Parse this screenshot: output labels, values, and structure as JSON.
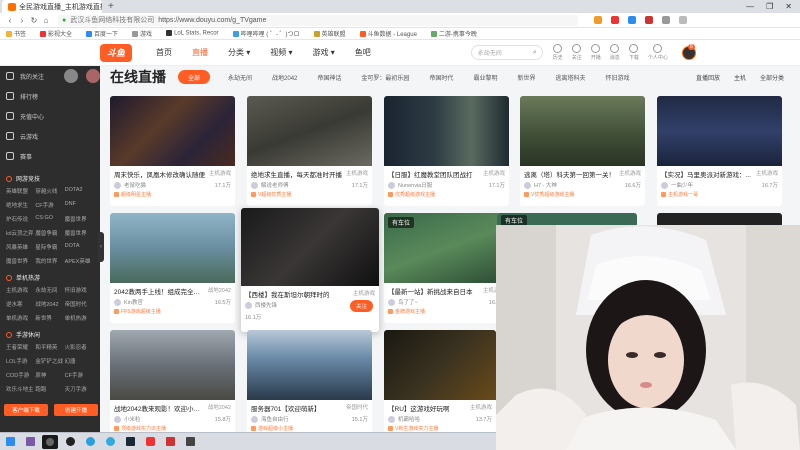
{
  "browser": {
    "tab_title": "全民游戏直播_主机游戏直播斗鱼",
    "window_buttons": [
      "—",
      "❐",
      "✕"
    ],
    "url_host": "武汉斗鱼网络科技有限公司",
    "url": "https://www.douyu.com/g_TVgame",
    "bookmarks": [
      "书签",
      "影视大全",
      "百度一下",
      "游戏",
      "LoL Stats, Recor",
      "哔哩哔哩 ( ゜- ゜)つロ",
      "英雄联盟",
      "斗鱼数据 - League",
      "二游-携事今晚"
    ]
  },
  "site": {
    "logo_text": "斗鱼",
    "nav": [
      {
        "label": "首页"
      },
      {
        "label": "直播",
        "active": true
      },
      {
        "label": "分类 ▾"
      },
      {
        "label": "视频 ▾"
      },
      {
        "label": "游戏 ▾"
      },
      {
        "label": "鱼吧"
      }
    ],
    "search_placeholder": "永劫无间",
    "header_icons": [
      "历史",
      "关注",
      "开播",
      "消息",
      "下载",
      "个人中心"
    ],
    "notification_count": "8"
  },
  "sidebar": {
    "items": [
      {
        "label": "我的关注"
      },
      {
        "label": "排行榜"
      },
      {
        "label": "充值中心"
      },
      {
        "label": "云游戏"
      },
      {
        "label": "赛事"
      }
    ],
    "groups": [
      {
        "title": "网游竞技",
        "games": [
          "英雄联盟",
          "穿越火线",
          "DOTA2",
          "绝地求生",
          "CF手游",
          "DNF",
          "炉石传说",
          "CS:GO",
          "魔兽世界",
          "lol云顶之弈",
          "魔兽争霸",
          "魔兽世界",
          "风暴英雄",
          "星际争霸",
          "DOTA",
          "魔兽世界",
          "我的世界",
          "APEX英雄"
        ]
      },
      {
        "title": "单机热游",
        "games": [
          "主机游戏",
          "永劫无间",
          "怀旧游戏",
          "逆水寒",
          "战地2042",
          "帝国时代",
          "单机游戏",
          "新世界",
          "单机热游"
        ]
      },
      {
        "title": "手游休闲",
        "games": [
          "王者荣耀",
          "和平精英",
          "火影忍者",
          "LOL手游",
          "金铲铲之战",
          "幻唐",
          "COD手游",
          "原神",
          "CF手游",
          "欢乐斗地主",
          "跑跑",
          "天刀手游"
        ]
      }
    ],
    "buttons": [
      "客户端下载",
      "创建开播"
    ]
  },
  "main": {
    "page_title": "在线直播",
    "all_button": "全部",
    "categories": [
      "永劫无间",
      "战地2042",
      "帝国神话",
      "金可罗：最初乐园",
      "帝国时代",
      "霸业黎明",
      "新世界",
      "逃离塔科夫",
      "怀旧游戏"
    ],
    "right_tools": [
      "直播回放",
      "主机",
      "全部分类"
    ],
    "cards": [
      {
        "title": "周末快乐，凤凰木修改确认随便",
        "category": "主机游戏",
        "streamer": "老鼠吃猫",
        "hot": "17.1万",
        "tag": "超级明星主播"
      },
      {
        "title": "绝地求生直播，每天都准时开播",
        "category": "主机游戏",
        "streamer": "解说老师傅",
        "hot": "17.1万",
        "tag": "V超级优质主播"
      },
      {
        "title": "【日服】红魔教堂团队团战打",
        "category": "主机游戏",
        "streamer": "Nunenvia日服",
        "hot": "17.1万",
        "tag": "优秀超级游戏主播"
      },
      {
        "title": "逃离（塔）科夫第一回第一关！",
        "category": "主机游戏",
        "streamer": "H7 - 大神",
        "hot": "16.6万",
        "tag": "V优秀超级游戏主播"
      },
      {
        "title": "【实况】马里奥派对新游戏：...",
        "category": "主机游戏",
        "streamer": "一曲少年",
        "hot": "16.7万",
        "tag": "主机游戏一哥"
      },
      {
        "title": "2042教两手上线！组成完全体！",
        "category": "战地2042",
        "streamer": "Kin教官",
        "hot": "16.5万",
        "tag": "FPS游戏超级主播"
      },
      {
        "title": "【最新一站】新挑战来自日本",
        "category": "主机游戏",
        "streamer": "鸟了了~",
        "hot": "16.3万",
        "tag": "金牌游戏主播"
      },
      {
        "title": "战地2042教来观影！欢迎小伙伴...",
        "category": "战地2042",
        "streamer": "小米粒",
        "hot": "15.8万",
        "tag": "顶级游戏实力派主播"
      },
      {
        "title": "服务器701【欢迎萌新】",
        "category": "帝国时代",
        "streamer": "海鱼自由行",
        "hot": "15.1万",
        "tag": "游戏超级小主播"
      },
      {
        "title": "【RU】这游戏好玩啊",
        "category": "主机游戏",
        "streamer": "机霸哈哈",
        "hot": "13.7万",
        "tag": "V新生游戏实力主播"
      }
    ],
    "popup_card": {
      "title": "【西楼】我在斯坦尔朝拜时的",
      "category": "主机游戏",
      "streamer": "西楼先锋",
      "hot": "16.1万",
      "follow_label": "关注"
    },
    "row2_extra": [
      {
        "badge": "有车位"
      },
      {
        "badge": "有车位"
      }
    ]
  },
  "taskbar": {
    "icons": [
      "start-icon",
      "app-icon",
      "obs-icon",
      "steam-icon",
      "edge-icon",
      "qq-icon",
      "steam-icon",
      "music-icon",
      "files-icon",
      "game-icon"
    ]
  },
  "colors": {
    "accent": "#ff5d23",
    "sidebar_bg": "#2d2d2d"
  }
}
